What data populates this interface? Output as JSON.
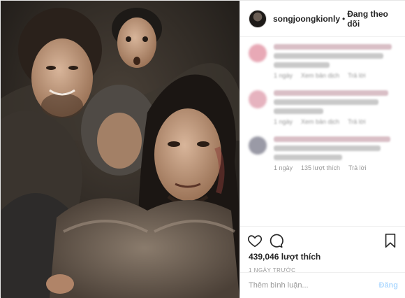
{
  "header": {
    "username": "songjoongkionly",
    "separator": "•",
    "follow_label": "Đang theo dõi"
  },
  "comments": [
    {
      "avatar_color": "#e8a9b6",
      "meta": [
        "1 ngày",
        "Xem bản dịch",
        "Trả lời"
      ],
      "blurred_meta": true
    },
    {
      "avatar_color": "#e6b3bf",
      "meta": [
        "1 ngày",
        "Xem bản dịch",
        "Trả lời"
      ],
      "blurred_meta": true
    },
    {
      "avatar_color": "#9a9aa6",
      "meta": [
        "1 ngày",
        "135 lượt thích",
        "Trả lời"
      ],
      "blurred_meta": false
    }
  ],
  "actions": {
    "likes": "439,046 lượt thích",
    "time": "1 NGÀY TRƯỚC"
  },
  "add_comment": {
    "placeholder": "Thêm bình luận...",
    "post_label": "Đăng"
  },
  "colors": {
    "post_button_disabled": "#b3dbff",
    "muted_text": "#999999"
  }
}
